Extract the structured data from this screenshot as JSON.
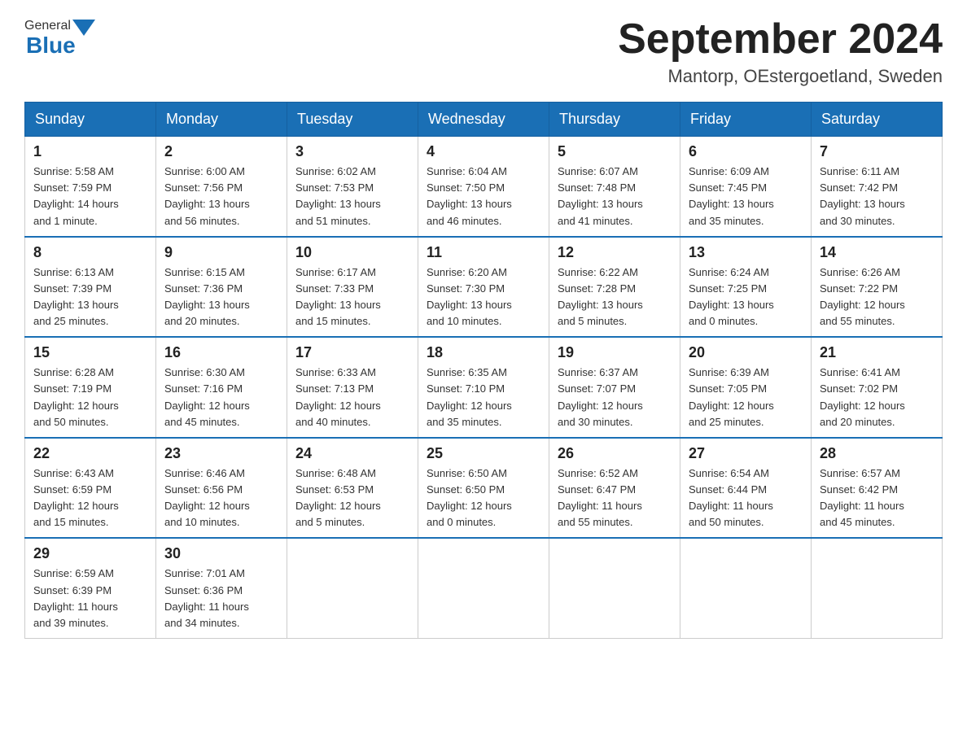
{
  "header": {
    "logo": {
      "general": "General",
      "blue": "Blue"
    },
    "title": "September 2024",
    "location": "Mantorp, OEstergoetland, Sweden"
  },
  "days_of_week": [
    "Sunday",
    "Monday",
    "Tuesday",
    "Wednesday",
    "Thursday",
    "Friday",
    "Saturday"
  ],
  "weeks": [
    [
      {
        "day": "1",
        "sunrise": "Sunrise: 5:58 AM",
        "sunset": "Sunset: 7:59 PM",
        "daylight": "Daylight: 14 hours and 1 minute."
      },
      {
        "day": "2",
        "sunrise": "Sunrise: 6:00 AM",
        "sunset": "Sunset: 7:56 PM",
        "daylight": "Daylight: 13 hours and 56 minutes."
      },
      {
        "day": "3",
        "sunrise": "Sunrise: 6:02 AM",
        "sunset": "Sunset: 7:53 PM",
        "daylight": "Daylight: 13 hours and 51 minutes."
      },
      {
        "day": "4",
        "sunrise": "Sunrise: 6:04 AM",
        "sunset": "Sunset: 7:50 PM",
        "daylight": "Daylight: 13 hours and 46 minutes."
      },
      {
        "day": "5",
        "sunrise": "Sunrise: 6:07 AM",
        "sunset": "Sunset: 7:48 PM",
        "daylight": "Daylight: 13 hours and 41 minutes."
      },
      {
        "day": "6",
        "sunrise": "Sunrise: 6:09 AM",
        "sunset": "Sunset: 7:45 PM",
        "daylight": "Daylight: 13 hours and 35 minutes."
      },
      {
        "day": "7",
        "sunrise": "Sunrise: 6:11 AM",
        "sunset": "Sunset: 7:42 PM",
        "daylight": "Daylight: 13 hours and 30 minutes."
      }
    ],
    [
      {
        "day": "8",
        "sunrise": "Sunrise: 6:13 AM",
        "sunset": "Sunset: 7:39 PM",
        "daylight": "Daylight: 13 hours and 25 minutes."
      },
      {
        "day": "9",
        "sunrise": "Sunrise: 6:15 AM",
        "sunset": "Sunset: 7:36 PM",
        "daylight": "Daylight: 13 hours and 20 minutes."
      },
      {
        "day": "10",
        "sunrise": "Sunrise: 6:17 AM",
        "sunset": "Sunset: 7:33 PM",
        "daylight": "Daylight: 13 hours and 15 minutes."
      },
      {
        "day": "11",
        "sunrise": "Sunrise: 6:20 AM",
        "sunset": "Sunset: 7:30 PM",
        "daylight": "Daylight: 13 hours and 10 minutes."
      },
      {
        "day": "12",
        "sunrise": "Sunrise: 6:22 AM",
        "sunset": "Sunset: 7:28 PM",
        "daylight": "Daylight: 13 hours and 5 minutes."
      },
      {
        "day": "13",
        "sunrise": "Sunrise: 6:24 AM",
        "sunset": "Sunset: 7:25 PM",
        "daylight": "Daylight: 13 hours and 0 minutes."
      },
      {
        "day": "14",
        "sunrise": "Sunrise: 6:26 AM",
        "sunset": "Sunset: 7:22 PM",
        "daylight": "Daylight: 12 hours and 55 minutes."
      }
    ],
    [
      {
        "day": "15",
        "sunrise": "Sunrise: 6:28 AM",
        "sunset": "Sunset: 7:19 PM",
        "daylight": "Daylight: 12 hours and 50 minutes."
      },
      {
        "day": "16",
        "sunrise": "Sunrise: 6:30 AM",
        "sunset": "Sunset: 7:16 PM",
        "daylight": "Daylight: 12 hours and 45 minutes."
      },
      {
        "day": "17",
        "sunrise": "Sunrise: 6:33 AM",
        "sunset": "Sunset: 7:13 PM",
        "daylight": "Daylight: 12 hours and 40 minutes."
      },
      {
        "day": "18",
        "sunrise": "Sunrise: 6:35 AM",
        "sunset": "Sunset: 7:10 PM",
        "daylight": "Daylight: 12 hours and 35 minutes."
      },
      {
        "day": "19",
        "sunrise": "Sunrise: 6:37 AM",
        "sunset": "Sunset: 7:07 PM",
        "daylight": "Daylight: 12 hours and 30 minutes."
      },
      {
        "day": "20",
        "sunrise": "Sunrise: 6:39 AM",
        "sunset": "Sunset: 7:05 PM",
        "daylight": "Daylight: 12 hours and 25 minutes."
      },
      {
        "day": "21",
        "sunrise": "Sunrise: 6:41 AM",
        "sunset": "Sunset: 7:02 PM",
        "daylight": "Daylight: 12 hours and 20 minutes."
      }
    ],
    [
      {
        "day": "22",
        "sunrise": "Sunrise: 6:43 AM",
        "sunset": "Sunset: 6:59 PM",
        "daylight": "Daylight: 12 hours and 15 minutes."
      },
      {
        "day": "23",
        "sunrise": "Sunrise: 6:46 AM",
        "sunset": "Sunset: 6:56 PM",
        "daylight": "Daylight: 12 hours and 10 minutes."
      },
      {
        "day": "24",
        "sunrise": "Sunrise: 6:48 AM",
        "sunset": "Sunset: 6:53 PM",
        "daylight": "Daylight: 12 hours and 5 minutes."
      },
      {
        "day": "25",
        "sunrise": "Sunrise: 6:50 AM",
        "sunset": "Sunset: 6:50 PM",
        "daylight": "Daylight: 12 hours and 0 minutes."
      },
      {
        "day": "26",
        "sunrise": "Sunrise: 6:52 AM",
        "sunset": "Sunset: 6:47 PM",
        "daylight": "Daylight: 11 hours and 55 minutes."
      },
      {
        "day": "27",
        "sunrise": "Sunrise: 6:54 AM",
        "sunset": "Sunset: 6:44 PM",
        "daylight": "Daylight: 11 hours and 50 minutes."
      },
      {
        "day": "28",
        "sunrise": "Sunrise: 6:57 AM",
        "sunset": "Sunset: 6:42 PM",
        "daylight": "Daylight: 11 hours and 45 minutes."
      }
    ],
    [
      {
        "day": "29",
        "sunrise": "Sunrise: 6:59 AM",
        "sunset": "Sunset: 6:39 PM",
        "daylight": "Daylight: 11 hours and 39 minutes."
      },
      {
        "day": "30",
        "sunrise": "Sunrise: 7:01 AM",
        "sunset": "Sunset: 6:36 PM",
        "daylight": "Daylight: 11 hours and 34 minutes."
      },
      null,
      null,
      null,
      null,
      null
    ]
  ]
}
